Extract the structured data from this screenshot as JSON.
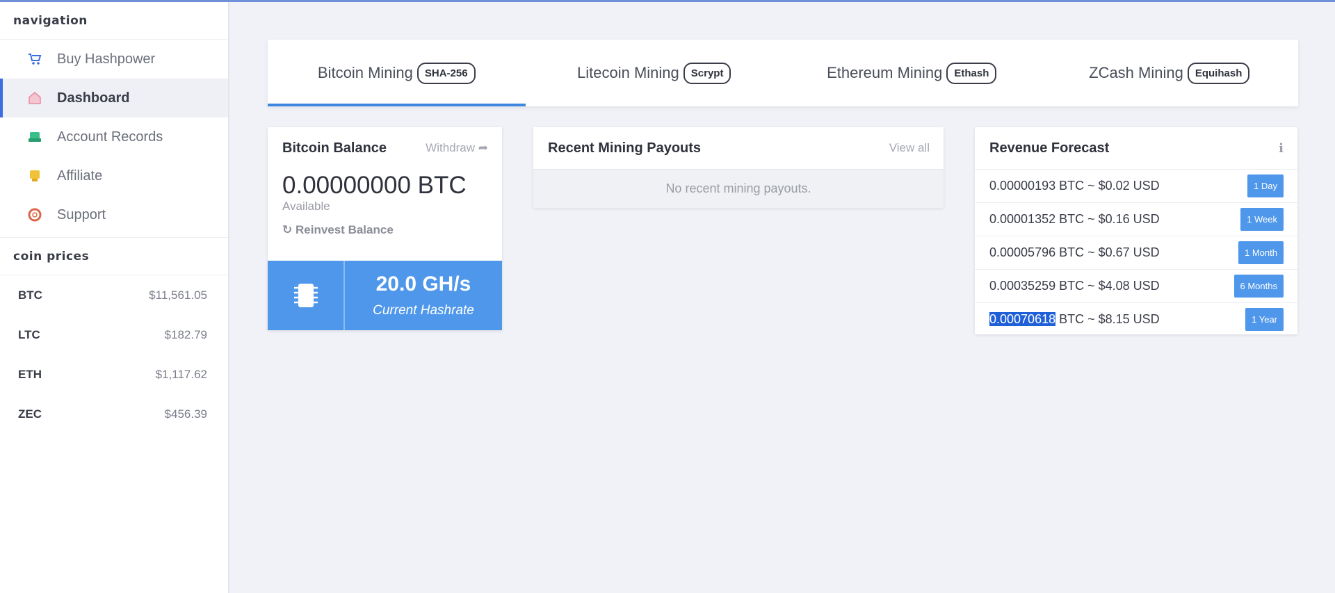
{
  "sidebar": {
    "nav_title": "navigation",
    "items": [
      {
        "label": "Buy Hashpower",
        "icon": "cart-icon",
        "color": "#3d6ee0"
      },
      {
        "label": "Dashboard",
        "icon": "home-icon",
        "color": "#e88aa3"
      },
      {
        "label": "Account Records",
        "icon": "records-icon",
        "color": "#3bbf8a"
      },
      {
        "label": "Affiliate",
        "icon": "affiliate-icon",
        "color": "#f0c23a"
      },
      {
        "label": "Support",
        "icon": "lifebuoy-icon",
        "color": "#d9674a"
      }
    ],
    "prices_title": "coin prices",
    "coins": [
      {
        "symbol": "BTC",
        "price": "$11,561.05"
      },
      {
        "symbol": "LTC",
        "price": "$182.79"
      },
      {
        "symbol": "ETH",
        "price": "$1,117.62"
      },
      {
        "symbol": "ZEC",
        "price": "$456.39"
      }
    ]
  },
  "tabs": [
    {
      "label": "Bitcoin Mining",
      "algo": "SHA-256"
    },
    {
      "label": "Litecoin Mining",
      "algo": "Scrypt"
    },
    {
      "label": "Ethereum Mining",
      "algo": "Ethash"
    },
    {
      "label": "ZCash Mining",
      "algo": "Equihash"
    }
  ],
  "balance": {
    "title": "Bitcoin Balance",
    "withdraw": "Withdraw",
    "amount": "0.00000000 BTC",
    "available": "Available",
    "reinvest": "Reinvest Balance",
    "hashrate": "20.0 GH/s",
    "hashrate_label": "Current Hashrate"
  },
  "payouts": {
    "title": "Recent Mining Payouts",
    "view_all": "View all",
    "empty": "No recent mining payouts."
  },
  "forecast": {
    "title": "Revenue Forecast",
    "rows": [
      {
        "text": "0.00000193 BTC ~ $0.02 USD",
        "period": "1 Day"
      },
      {
        "text": "0.00001352 BTC ~ $0.16 USD",
        "period": "1 Week"
      },
      {
        "text": "0.00005796 BTC ~ $0.67 USD",
        "period": "1 Month"
      },
      {
        "text": "0.00035259 BTC ~ $4.08 USD",
        "period": "6 Months"
      },
      {
        "btc": "0.00070618",
        "rest": " BTC ~ $8.15 USD",
        "period": "1 Year"
      }
    ]
  }
}
